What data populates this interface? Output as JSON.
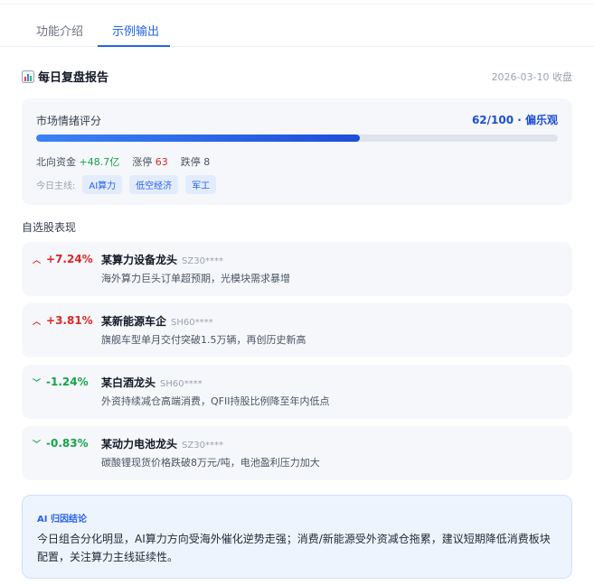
{
  "tabs": [
    {
      "label": "功能介绍",
      "active": false
    },
    {
      "label": "示例输出",
      "active": true
    }
  ],
  "report": {
    "icon": "bar-chart-icon",
    "title": "每日复盘报告",
    "date": "2026-03-10 收盘"
  },
  "sentiment": {
    "label": "市场情绪评分",
    "score_text": "62/100 · 偏乐观",
    "score": 62,
    "max": 100,
    "stats": {
      "northbound_label": "北向资金",
      "northbound_value": "+48.7亿",
      "limit_up_label": "涨停",
      "limit_up_value": "63",
      "limit_down_label": "跌停",
      "limit_down_value": "8"
    },
    "themes_label": "今日主线:",
    "themes": [
      "AI算力",
      "低空经济",
      "军工"
    ]
  },
  "watchlist": {
    "title": "自选股表现",
    "items": [
      {
        "direction": "up",
        "change": "+7.24%",
        "name": "某算力设备龙头",
        "code": "SZ30****",
        "desc": "海外算力巨头订单超预期，光模块需求暴增"
      },
      {
        "direction": "up",
        "change": "+3.81%",
        "name": "某新能源车企",
        "code": "SH60****",
        "desc": "旗舰车型单月交付突破1.5万辆，再创历史新高"
      },
      {
        "direction": "down",
        "change": "-1.24%",
        "name": "某白酒龙头",
        "code": "SH60****",
        "desc": "外资持续减仓高端消费，QFII持股比例降至年内低点"
      },
      {
        "direction": "down",
        "change": "-0.83%",
        "name": "某动力电池龙头",
        "code": "SZ30****",
        "desc": "碳酸锂现货价格跌破8万元/吨，电池盈利压力加大"
      }
    ]
  },
  "ai_conclusion": {
    "label": "AI 归因结论",
    "text": "今日组合分化明显，AI算力方向受海外催化逆势走强；消费/新能源受外资减仓拖累，建议短期降低消费板块配置，关注算力主线延续性。"
  },
  "colors": {
    "accent": "#2563eb",
    "up": "#dc2626",
    "down": "#16a34a"
  }
}
